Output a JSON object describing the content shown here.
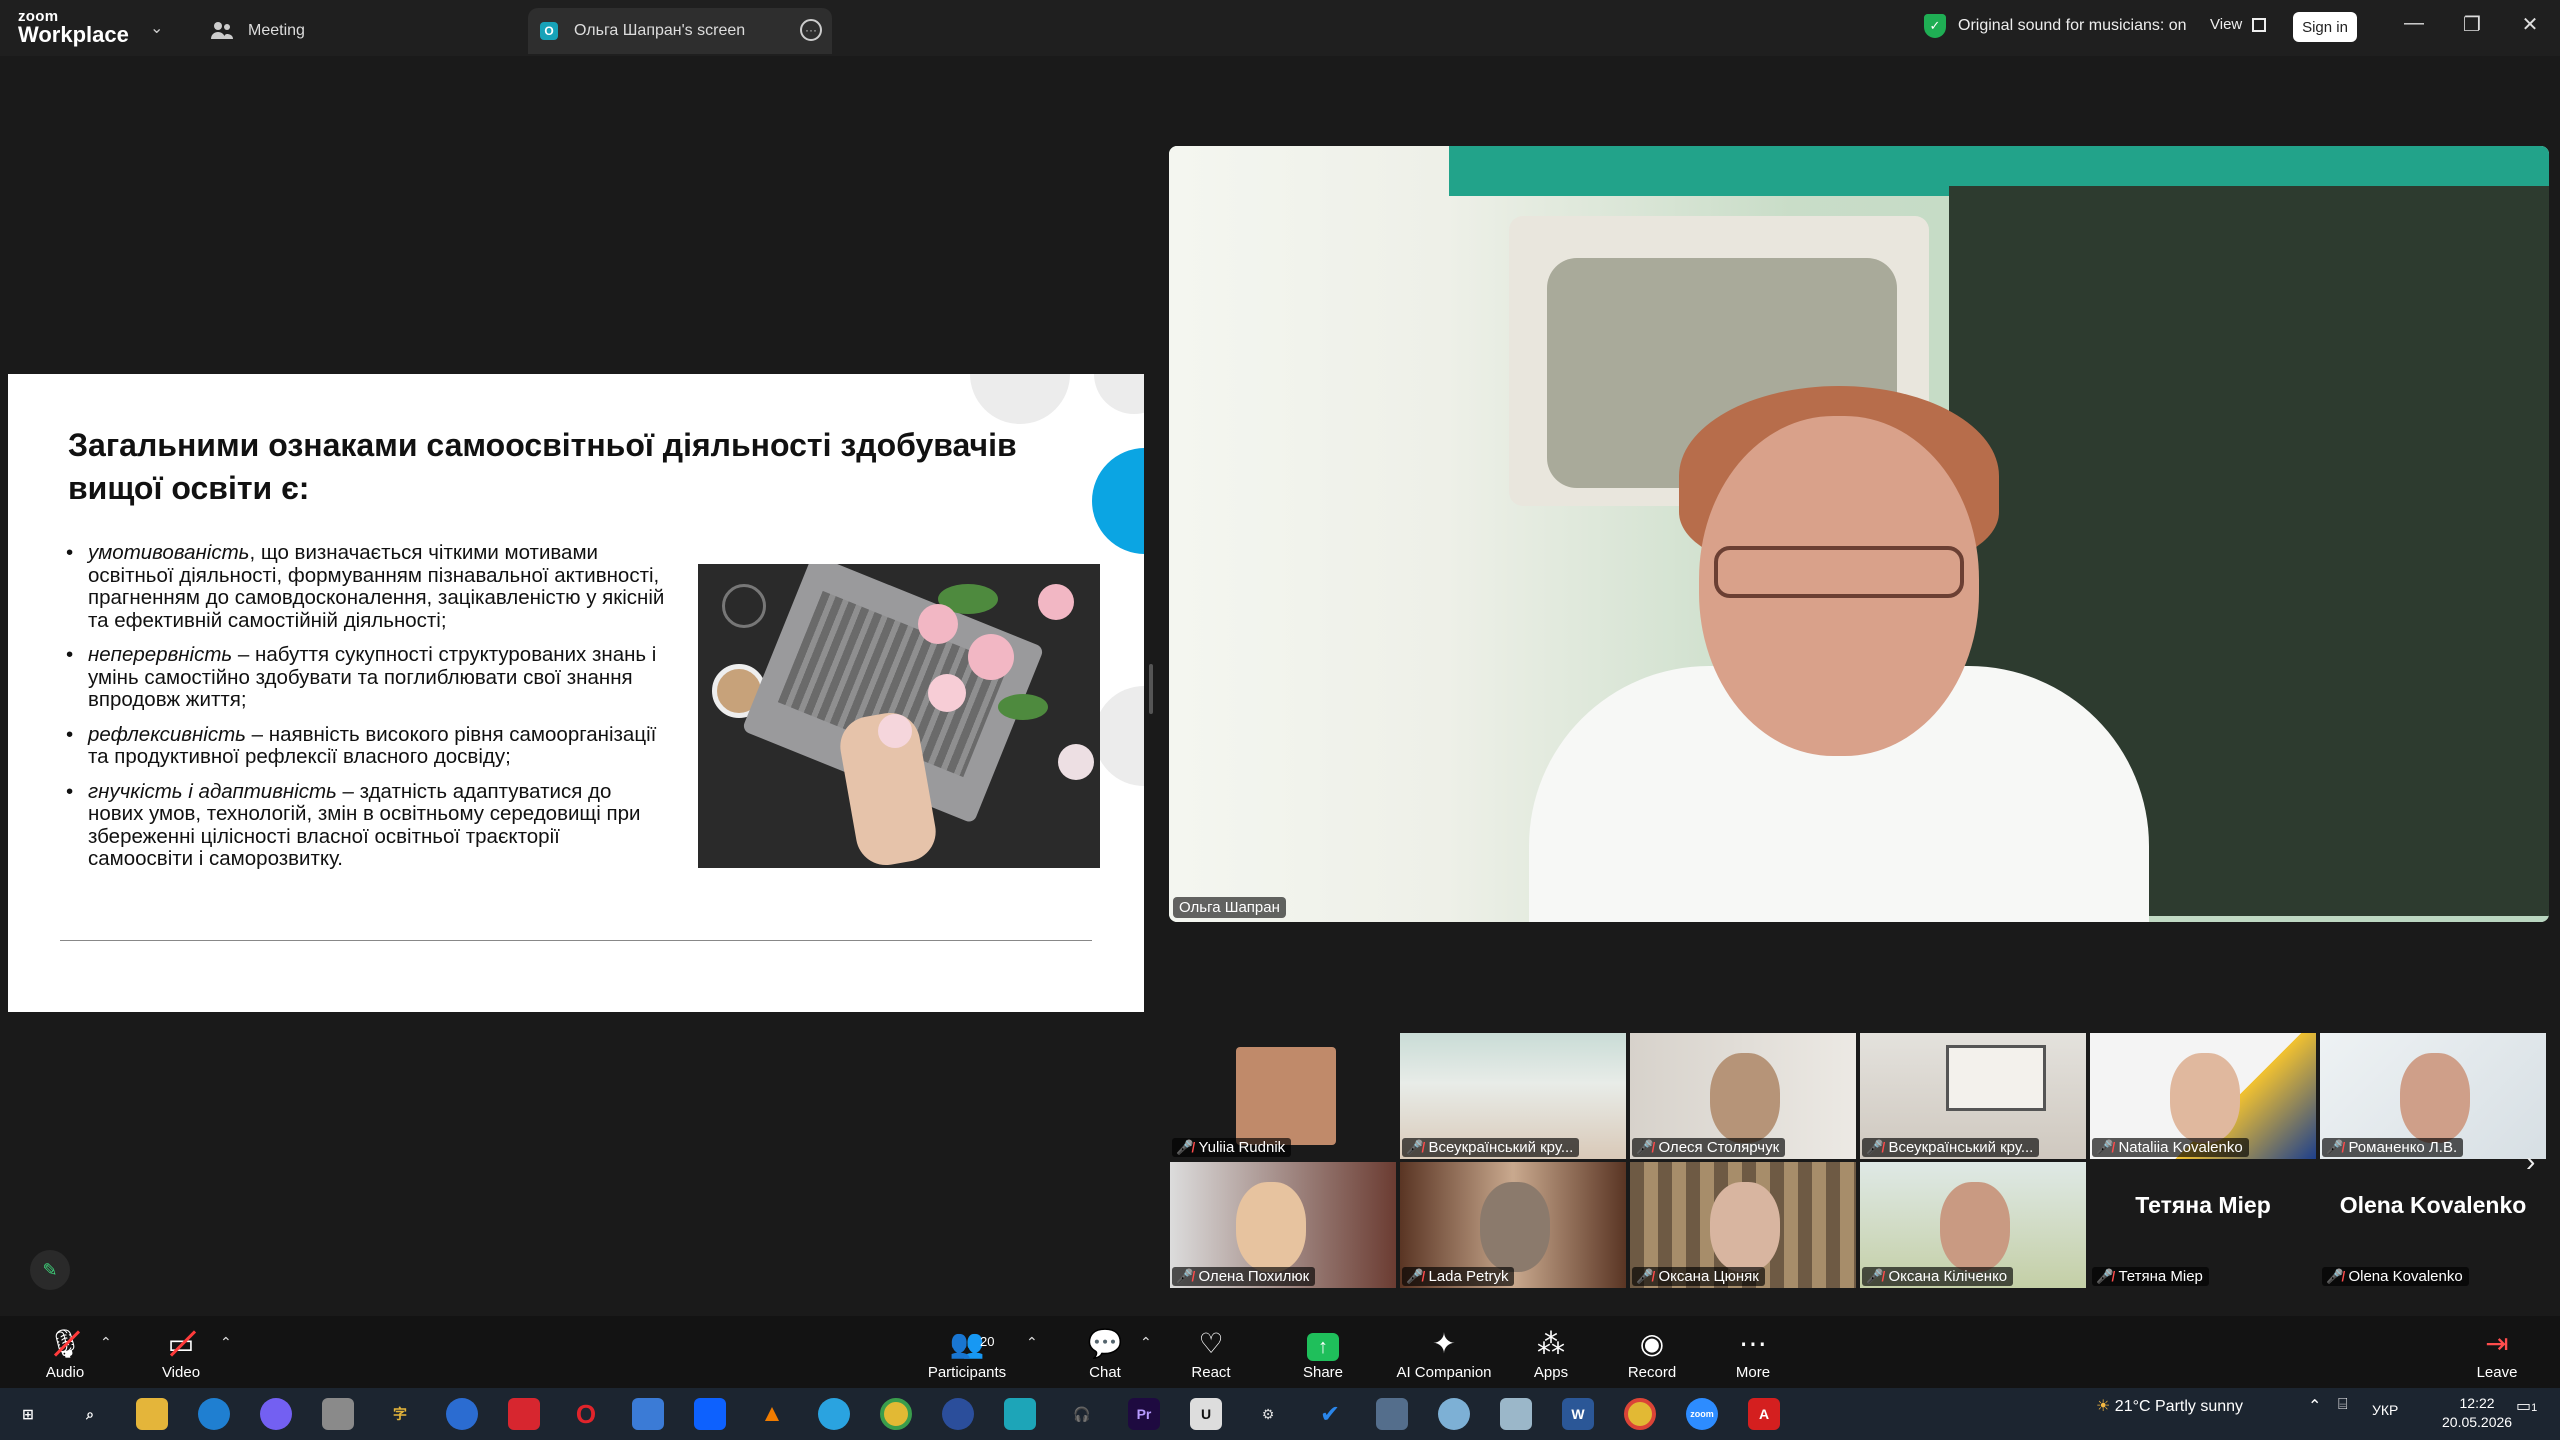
{
  "titlebar": {
    "logo_top": "zoom",
    "logo_bottom": "Workplace",
    "tab_meeting": "Meeting",
    "tab_share_badge": "O",
    "tab_share": "Ольга Шапран's screen",
    "original_sound": "Original sound for musicians: on",
    "view": "View",
    "sign_in": "Sign in"
  },
  "slide": {
    "title": "Загальними ознаками самоосвітньої діяльності здобувачів вищої освіти є:",
    "items": [
      {
        "term": " умотивованість",
        "text": ", що визначається чіткими мотивами освітньої діяльності, формуванням пізнавальної активності, прагненням до самовдосконалення, зацікавленістю у якісній та ефективній самостійній діяльності;"
      },
      {
        "term": "неперервність",
        "text": " – набуття сукупності  структурованих знань і умінь самостійно здобувати та поглиблювати свої знання впродовж життя;"
      },
      {
        "term": "рефлексивність",
        "text": " – наявність високого рівня самоорганізації та продуктивної рефлексії власного досвіду;"
      },
      {
        "term": "гнучкість і адаптивність",
        "text": " – здатність адаптуватися до нових умов, технологій, змін в освітньому середовищі при збереженні цілісності власної освітньої траєкторії самоосвіти і саморозвитку."
      }
    ]
  },
  "speaker": {
    "name": "Ольга Шапран"
  },
  "gallery": {
    "row1": [
      {
        "name": "Yuliia Rudnik"
      },
      {
        "name": "Всеукраїнський кру..."
      },
      {
        "name": "Олеся Столярчук"
      },
      {
        "name": "Всеукраїнський кру..."
      },
      {
        "name": "Nataliia Kovalenko"
      },
      {
        "name": "Романенко Л.В."
      }
    ],
    "row2": [
      {
        "name": "Олена Похилюк"
      },
      {
        "name": "Lada Petryk"
      },
      {
        "name": "Оксана Цюняк"
      },
      {
        "name": "Оксана Кіліченко"
      },
      {
        "name": "Тетяна Міер",
        "display": "Тетяна Міер"
      },
      {
        "name": "Olena Kovalenko",
        "display": "Olena Kovalenko"
      }
    ]
  },
  "toolbar": {
    "audio": "Audio",
    "video": "Video",
    "participants": "Participants",
    "participants_count": "20",
    "chat": "Chat",
    "react": "React",
    "share": "Share",
    "ai": "AI Companion",
    "apps": "Apps",
    "record": "Record",
    "more": "More",
    "leave": "Leave"
  },
  "taskbar": {
    "weather": "21°C  Partly sunny",
    "lang": "УКР",
    "time": "12:22",
    "date": "20.05.2026",
    "notif": "1"
  },
  "colors": {
    "accent_blue": "#0ba5e3",
    "mute_red": "#ff4d4d",
    "share_green": "#1fbf5b"
  }
}
